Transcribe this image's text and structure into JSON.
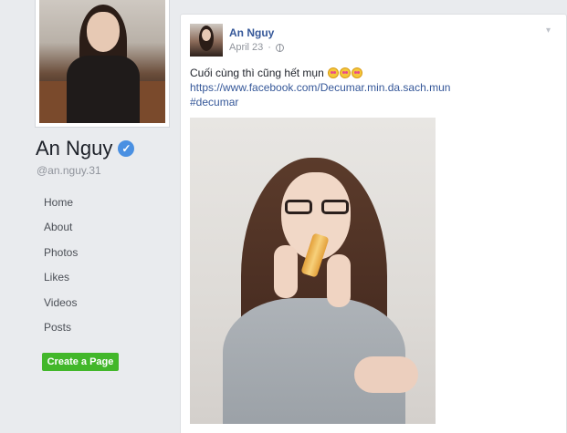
{
  "profile": {
    "name": "An Nguy",
    "handle": "@an.nguy.31"
  },
  "nav": {
    "items": [
      {
        "label": "Home"
      },
      {
        "label": "About"
      },
      {
        "label": "Photos"
      },
      {
        "label": "Likes"
      },
      {
        "label": "Videos"
      },
      {
        "label": "Posts"
      }
    ],
    "create_page_label": "Create a Page"
  },
  "post": {
    "author": "An Nguy",
    "date": "April 23",
    "privacy_icon": "globe-icon",
    "text": "Cuối cùng thì cũng hết mụn",
    "emoji_count": 3,
    "link": "https://www.facebook.com/Decumar.min.da.sach.mun",
    "hashtag": "#decumar"
  },
  "colors": {
    "link": "#365899",
    "create_page_button": "#42b72a",
    "verified_badge": "#4a90e2",
    "background": "#e9ebee"
  }
}
